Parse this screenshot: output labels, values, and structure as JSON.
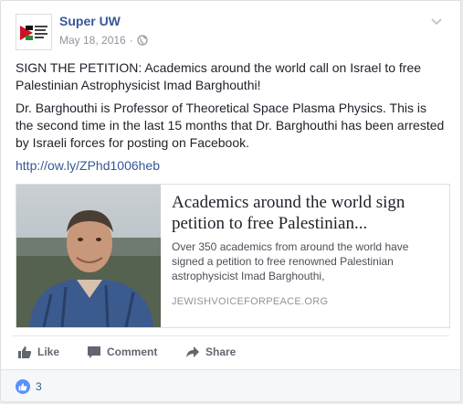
{
  "post": {
    "author": "Super UW",
    "date": "May 18, 2016",
    "separator": "·",
    "paragraph1": "SIGN THE PETITION: Academics around the world call on Israel to free Palestinian Astrophysicist Imad Barghouthi!",
    "paragraph2": "Dr. Barghouthi is Professor of Theoretical Space Plasma Physics. This is the second time in the last 15 months that Dr. Barghouthi has been arrested by Israeli forces for posting on Facebook.",
    "link": "http://ow.ly/ZPhd1006heb"
  },
  "preview": {
    "title": "Academics around the world sign petition to free Palestinian...",
    "description": "Over 350 academics from around the world have signed a petition to free renowned Palestinian astrophysicist Imad Barghouthi,",
    "domain": "JEWISHVOICEFORPEACE.ORG"
  },
  "actions": {
    "like": "Like",
    "comment": "Comment",
    "share": "Share"
  },
  "reactions": {
    "count": "3"
  },
  "colors": {
    "link_blue": "#365899",
    "like_blue": "#5890ff"
  }
}
